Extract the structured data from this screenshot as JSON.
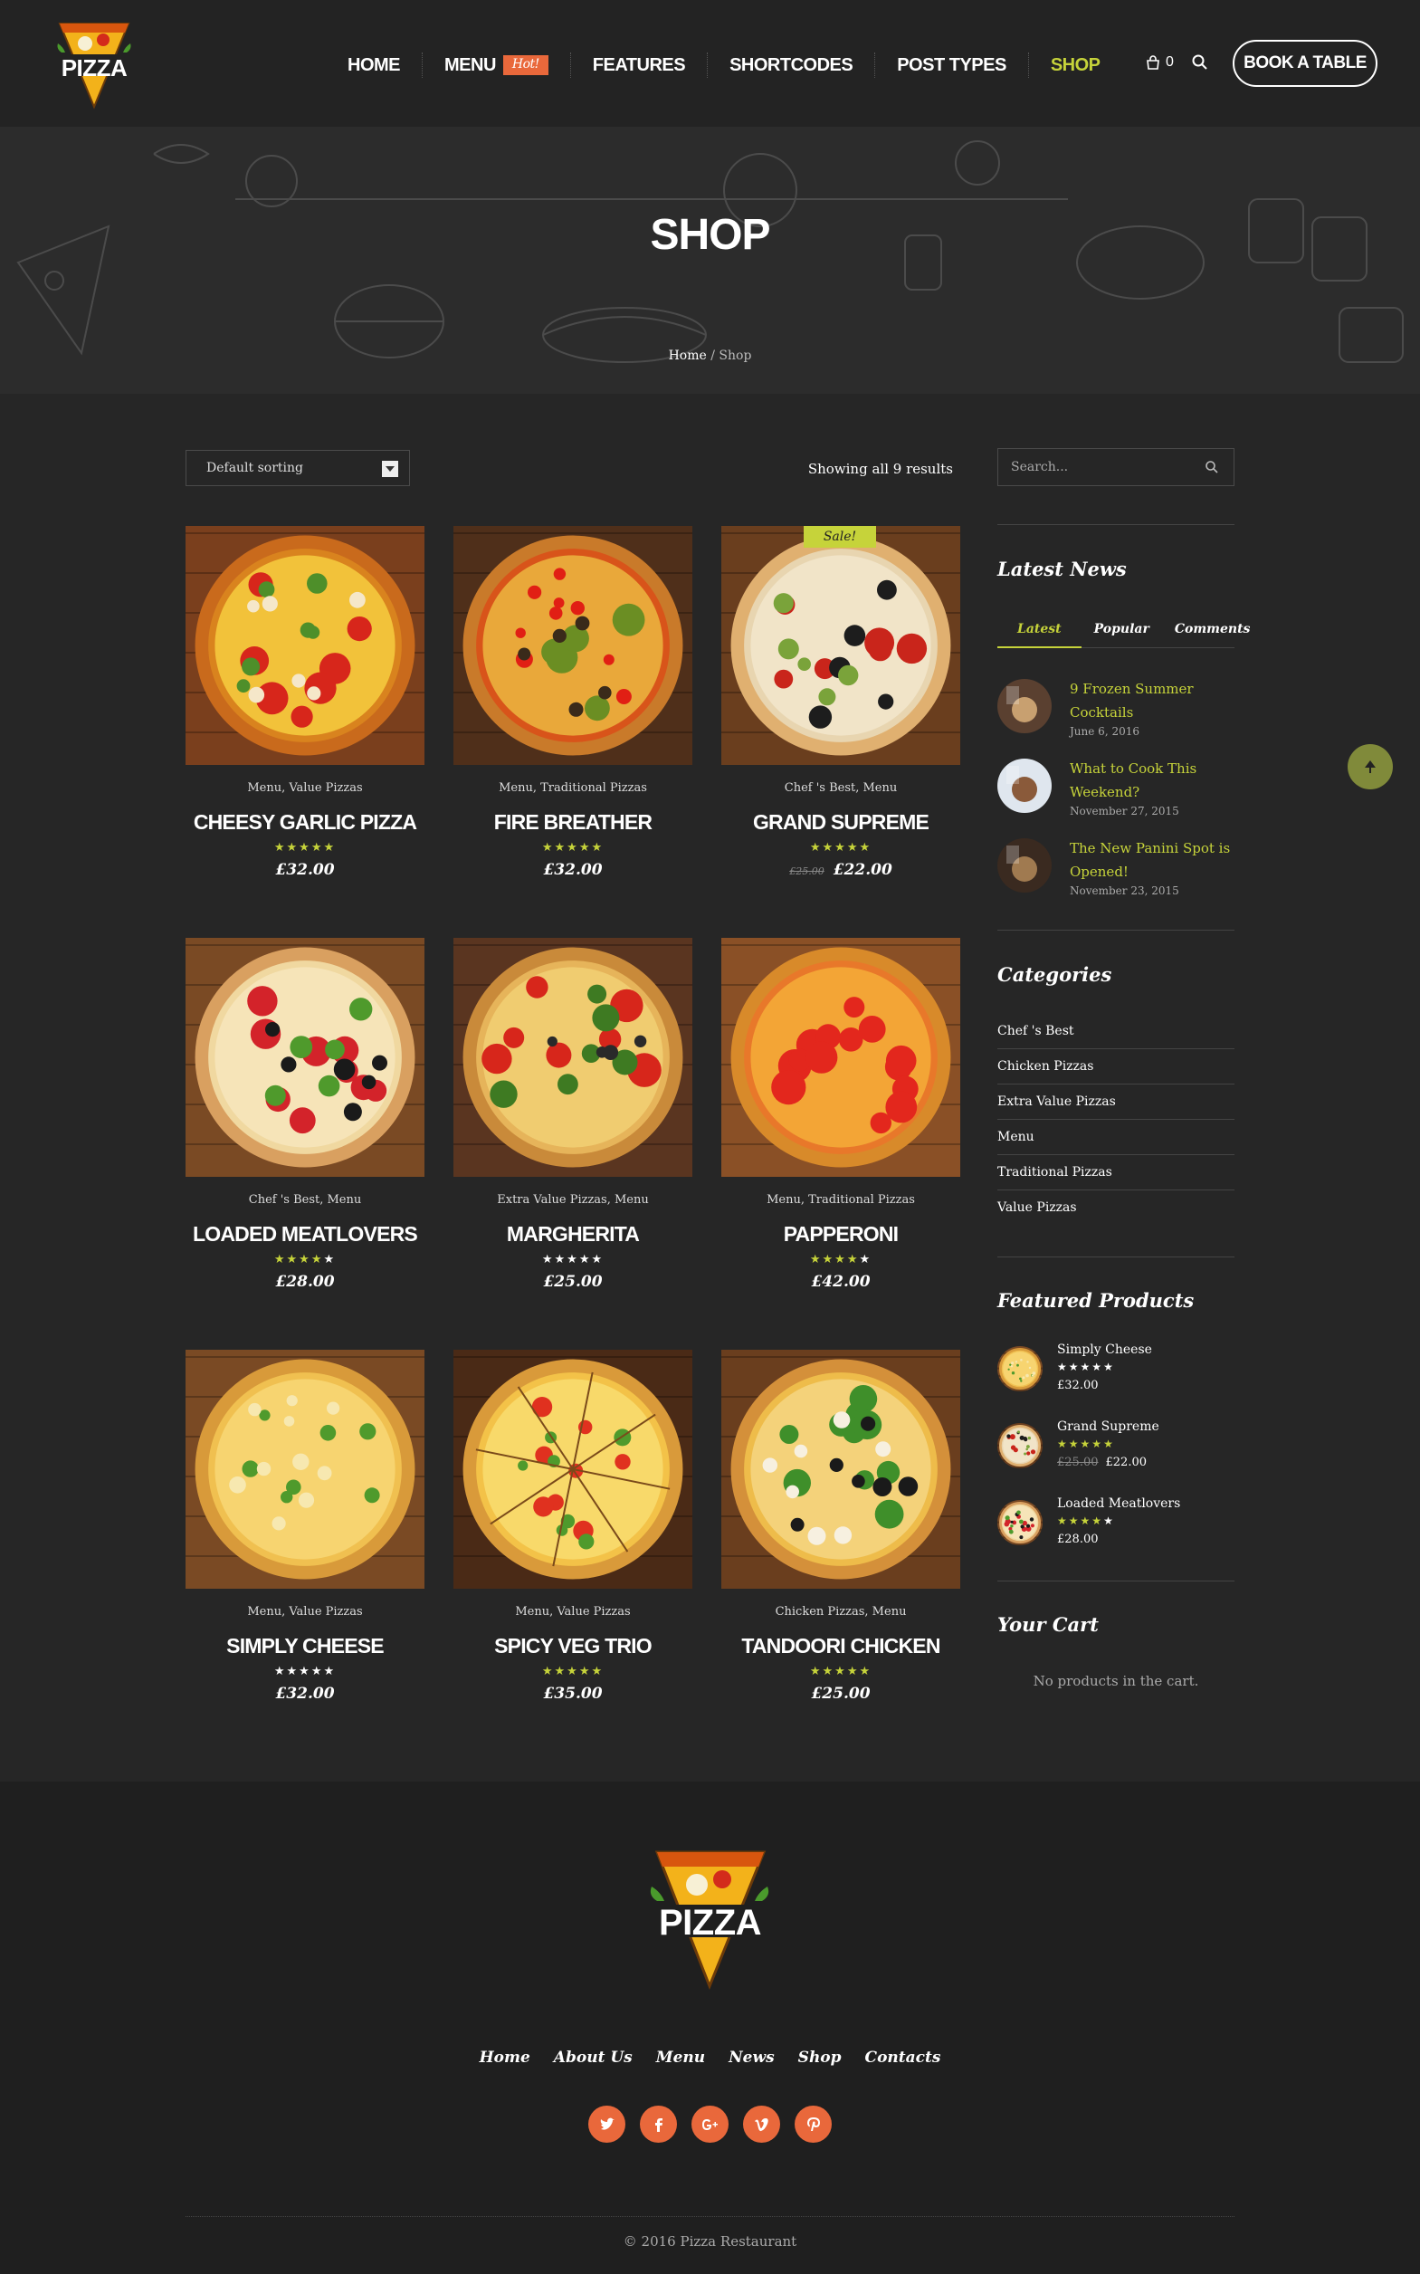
{
  "header": {
    "nav": [
      {
        "label": "HOME"
      },
      {
        "label": "MENU",
        "badge": "Hot!"
      },
      {
        "label": "FEATURES"
      },
      {
        "label": "SHORTCODES"
      },
      {
        "label": "POST TYPES"
      },
      {
        "label": "SHOP",
        "active": true
      }
    ],
    "cart_count": "0",
    "book_label": "BOOK A TABLE",
    "logo_text": "PIZZA"
  },
  "hero": {
    "title": "SHOP",
    "breadcrumb": {
      "home": "Home",
      "separator": "/",
      "current": "Shop"
    }
  },
  "toolbar": {
    "sorting": "Default sorting",
    "results": "Showing all 9 results"
  },
  "products": [
    {
      "cats": "Menu, Value Pizzas",
      "name": "CHEESY GARLIC PIZZA",
      "rating": 5,
      "price": "£32.00",
      "old_price": ""
    },
    {
      "cats": "Menu, Traditional Pizzas",
      "name": "FIRE BREATHER",
      "rating": 5,
      "price": "£32.00",
      "old_price": ""
    },
    {
      "cats": "Chef 's Best, Menu",
      "name": "GRAND SUPREME",
      "rating": 5,
      "price": "£22.00",
      "old_price": "£25.00",
      "sale": "Sale!"
    },
    {
      "cats": "Chef 's Best, Menu",
      "name": "LOADED MEATLOVERS",
      "rating": 4,
      "price": "£28.00",
      "old_price": ""
    },
    {
      "cats": "Extra Value Pizzas, Menu",
      "name": "MARGHERITA",
      "rating": 0,
      "price": "£25.00",
      "old_price": ""
    },
    {
      "cats": "Menu, Traditional Pizzas",
      "name": "PAPPERONI",
      "rating": 4,
      "price": "£42.00",
      "old_price": ""
    },
    {
      "cats": "Menu, Value Pizzas",
      "name": "SIMPLY CHEESE",
      "rating": 0,
      "price": "£32.00",
      "old_price": ""
    },
    {
      "cats": "Menu, Value Pizzas",
      "name": "SPICY VEG TRIO",
      "rating": 5,
      "price": "£35.00",
      "old_price": ""
    },
    {
      "cats": "Chicken Pizzas, Menu",
      "name": "TANDOORI CHICKEN",
      "rating": 5,
      "price": "£25.00",
      "old_price": ""
    }
  ],
  "sidebar": {
    "search_placeholder": "Search...",
    "latest_news": {
      "title": "Latest News",
      "tabs": [
        "Latest",
        "Popular",
        "Comments"
      ],
      "items": [
        {
          "title": "9 Frozen Summer Cocktails",
          "date": "June 6, 2016"
        },
        {
          "title": "What to Cook This Weekend?",
          "date": "November 27, 2015"
        },
        {
          "title": "The New Panini Spot is Opened!",
          "date": "November 23, 2015"
        }
      ]
    },
    "categories": {
      "title": "Categories",
      "items": [
        "Chef 's Best",
        "Chicken Pizzas",
        "Extra Value Pizzas",
        "Menu",
        "Traditional Pizzas",
        "Value Pizzas"
      ]
    },
    "featured": {
      "title": "Featured Products",
      "items": [
        {
          "name": "Simply Cheese",
          "rating": 0,
          "price": "£32.00",
          "old_price": ""
        },
        {
          "name": "Grand Supreme",
          "rating": 5,
          "price": "£22.00",
          "old_price": "£25.00"
        },
        {
          "name": "Loaded Meatlovers",
          "rating": 4,
          "price": "£28.00",
          "old_price": ""
        }
      ]
    },
    "cart": {
      "title": "Your Cart",
      "empty": "No products in the cart."
    }
  },
  "footer": {
    "logo_text": "PIZZA",
    "nav": [
      "Home",
      "About Us",
      "Menu",
      "News",
      "Shop",
      "Contacts"
    ],
    "social": [
      "twitter-icon",
      "facebook-icon",
      "google-plus-icon",
      "vimeo-icon",
      "pinterest-icon"
    ],
    "copyright": "© 2016 Pizza Restaurant"
  },
  "colors": {
    "accent": "#c6d33a",
    "orange": "#e9683b",
    "bg": "#262626"
  }
}
